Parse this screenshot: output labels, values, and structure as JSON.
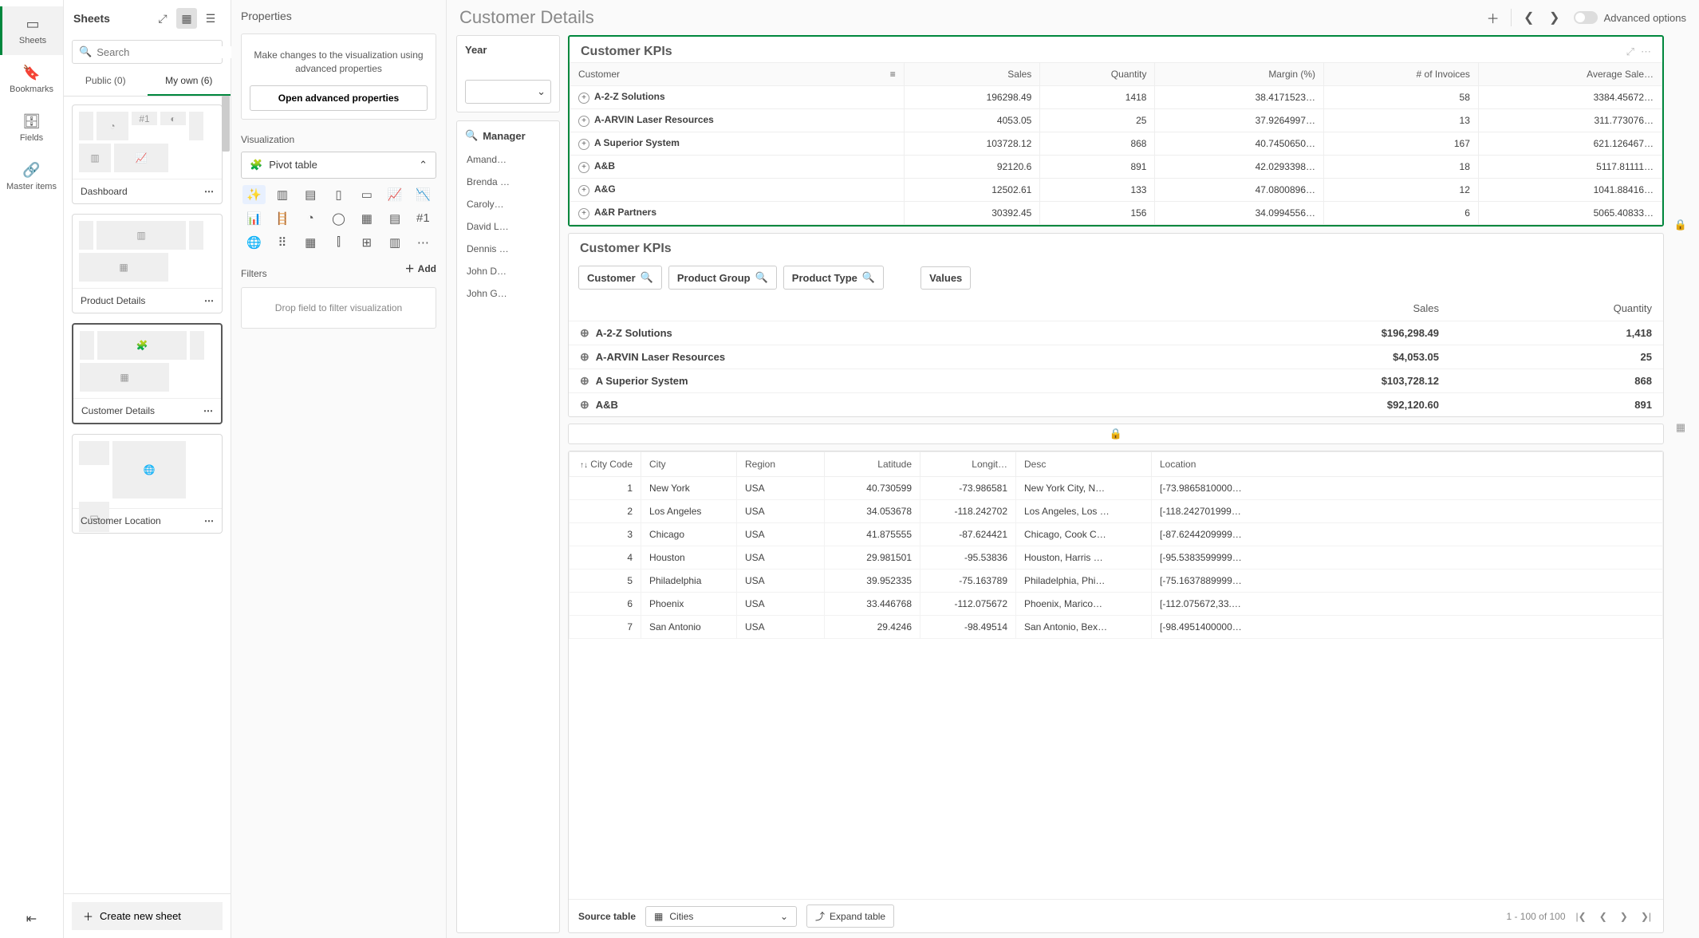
{
  "vsidebar": {
    "sheets": "Sheets",
    "bookmarks": "Bookmarks",
    "fields": "Fields",
    "master": "Master items"
  },
  "sheetsPanel": {
    "title": "Sheets",
    "searchPlaceholder": "Search",
    "tabs": {
      "public": "Public (0)",
      "mine": "My own (6)"
    },
    "cards": {
      "dashboard": "Dashboard",
      "product": "Product Details",
      "customer": "Customer Details",
      "location": "Customer Location"
    },
    "createLabel": "Create new sheet"
  },
  "props": {
    "title": "Properties",
    "note": "Make changes to the visualization using advanced properties",
    "advBtn": "Open advanced properties",
    "vizSection": "Visualization",
    "vizName": "Pivot table",
    "filtersSection": "Filters",
    "addLabel": "Add",
    "dropHint": "Drop field to filter visualization"
  },
  "canvas": {
    "title": "Customer Details",
    "advanced": "Advanced options"
  },
  "yearCard": "Year",
  "managerCard": {
    "title": "Manager",
    "items": [
      "Amand…",
      "Brenda …",
      "Caroly…",
      "David L…",
      "Dennis …",
      "John D…",
      "John G…"
    ]
  },
  "kpi1": {
    "title": "Customer KPIs",
    "cols": [
      "Customer",
      "Sales",
      "Quantity",
      "Margin (%)",
      "# of Invoices",
      "Average Sale…"
    ],
    "rows": [
      {
        "n": "A-2-Z Solutions",
        "s": "196298.49",
        "q": "1418",
        "m": "38.4171523…",
        "i": "58",
        "a": "3384.45672…"
      },
      {
        "n": "A-ARVIN Laser Resources",
        "s": "4053.05",
        "q": "25",
        "m": "37.9264997…",
        "i": "13",
        "a": "311.773076…"
      },
      {
        "n": "A Superior System",
        "s": "103728.12",
        "q": "868",
        "m": "40.7450650…",
        "i": "167",
        "a": "621.126467…"
      },
      {
        "n": "A&B",
        "s": "92120.6",
        "q": "891",
        "m": "42.0293398…",
        "i": "18",
        "a": "5117.81111…"
      },
      {
        "n": "A&G",
        "s": "12502.61",
        "q": "133",
        "m": "47.0800896…",
        "i": "12",
        "a": "1041.88416…"
      },
      {
        "n": "A&R Partners",
        "s": "30392.45",
        "q": "156",
        "m": "34.0994556…",
        "i": "6",
        "a": "5065.40833…"
      }
    ]
  },
  "kpi2": {
    "title": "Customer KPIs",
    "pills": {
      "customer": "Customer",
      "group": "Product Group",
      "type": "Product Type",
      "values": "Values"
    },
    "cols": {
      "sales": "Sales",
      "quantity": "Quantity"
    },
    "rows": [
      {
        "n": "A-2-Z Solutions",
        "s": "$196,298.49",
        "q": "1,418"
      },
      {
        "n": "A-ARVIN Laser Resources",
        "s": "$4,053.05",
        "q": "25"
      },
      {
        "n": "A Superior System",
        "s": "$103,728.12",
        "q": "868"
      },
      {
        "n": "A&B",
        "s": "$92,120.60",
        "q": "891"
      }
    ]
  },
  "cities": {
    "cols": [
      "City Code",
      "City",
      "Region",
      "Latitude",
      "Longit…",
      "Desc",
      "Location"
    ],
    "rows": [
      {
        "c": "1",
        "city": "New York",
        "reg": "USA",
        "lat": "40.730599",
        "lon": "-73.986581",
        "d": "New York City, N…",
        "loc": "[-73.9865810000…"
      },
      {
        "c": "2",
        "city": "Los Angeles",
        "reg": "USA",
        "lat": "34.053678",
        "lon": "-118.242702",
        "d": "Los Angeles, Los …",
        "loc": "[-118.242701999…"
      },
      {
        "c": "3",
        "city": "Chicago",
        "reg": "USA",
        "lat": "41.875555",
        "lon": "-87.624421",
        "d": "Chicago, Cook C…",
        "loc": "[-87.6244209999…"
      },
      {
        "c": "4",
        "city": "Houston",
        "reg": "USA",
        "lat": "29.981501",
        "lon": "-95.53836",
        "d": "Houston, Harris …",
        "loc": "[-95.5383599999…"
      },
      {
        "c": "5",
        "city": "Philadelphia",
        "reg": "USA",
        "lat": "39.952335",
        "lon": "-75.163789",
        "d": "Philadelphia, Phi…",
        "loc": "[-75.1637889999…"
      },
      {
        "c": "6",
        "city": "Phoenix",
        "reg": "USA",
        "lat": "33.446768",
        "lon": "-112.075672",
        "d": "Phoenix, Marico…",
        "loc": "[-112.075672,33.…"
      },
      {
        "c": "7",
        "city": "San Antonio",
        "reg": "USA",
        "lat": "29.4246",
        "lon": "-98.49514",
        "d": "San Antonio, Bex…",
        "loc": "[-98.4951400000…"
      }
    ],
    "sourceLabel": "Source table",
    "sourceValue": "Cities",
    "expand": "Expand table",
    "pager": "1 - 100 of 100"
  }
}
